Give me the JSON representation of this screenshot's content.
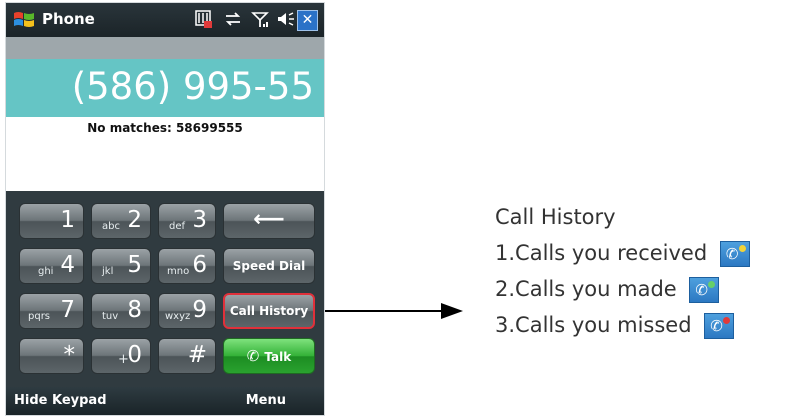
{
  "titlebar": {
    "title": "Phone",
    "status_icons": [
      "sim-icon",
      "sync-arrows-icon",
      "signal-icon",
      "speaker-icon"
    ],
    "close_label": "✕"
  },
  "dialer": {
    "number": "(586) 995-55",
    "matches": "No matches: 58699555"
  },
  "keypad": {
    "keys": [
      {
        "sub": "",
        "main": "1"
      },
      {
        "sub": "abc",
        "main": "2"
      },
      {
        "sub": "def",
        "main": "3"
      },
      {
        "sub": "ghi",
        "main": "4"
      },
      {
        "sub": "jkl",
        "main": "5"
      },
      {
        "sub": "mno",
        "main": "6"
      },
      {
        "sub": "pqrs",
        "main": "7"
      },
      {
        "sub": "tuv",
        "main": "8"
      },
      {
        "sub": "wxyz",
        "main": "9"
      },
      {
        "sub": "",
        "main": "*"
      },
      {
        "sub": "+",
        "main": "0"
      },
      {
        "sub": "",
        "main": "#"
      }
    ],
    "backspace": "⟵",
    "speed_dial": "Speed Dial",
    "call_history": "Call History",
    "talk": "Talk"
  },
  "softkeys": {
    "left": "Hide Keypad",
    "right": "Menu"
  },
  "legend": {
    "heading": "Call History",
    "items": [
      {
        "text": "1.Calls you received",
        "icon": "received-call-icon",
        "badge_color": "#f1d33a"
      },
      {
        "text": "2.Calls you made",
        "icon": "made-call-icon",
        "badge_color": "#66d06a"
      },
      {
        "text": "3.Calls you missed",
        "icon": "missed-call-icon",
        "badge_color": "#e03a3a"
      }
    ]
  },
  "colors": {
    "accent_teal": "#65c5c5",
    "highlight_red": "#e0303a",
    "talk_green": "#33b137"
  }
}
